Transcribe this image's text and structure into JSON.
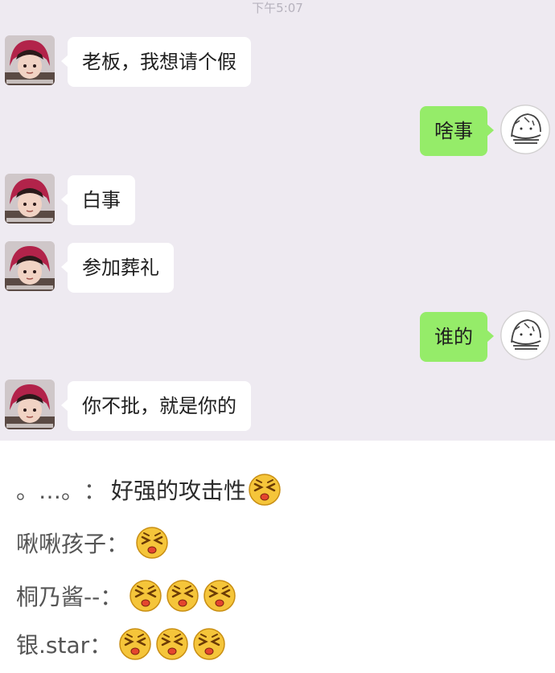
{
  "chat": {
    "time": "下午5:07",
    "messages": [
      {
        "side": "left",
        "text": "老板，我想请个假",
        "avatar": "girl-avatar-icon"
      },
      {
        "side": "right",
        "text": "啥事",
        "avatar": "sketch-avatar-icon"
      },
      {
        "side": "left",
        "text": "白事",
        "avatar": "girl-avatar-icon"
      },
      {
        "side": "left",
        "text": "参加葬礼",
        "avatar": "girl-avatar-icon"
      },
      {
        "side": "right",
        "text": "谁的",
        "avatar": "sketch-avatar-icon"
      },
      {
        "side": "left",
        "text": "你不批，就是你的",
        "avatar": "girl-avatar-icon"
      }
    ]
  },
  "comments": [
    {
      "name": "。…。",
      "sep": "：",
      "text": "好强的攻击性",
      "emoji_count": 1
    },
    {
      "name": "啾啾孩子",
      "sep": "：",
      "text": "",
      "emoji_count": 1
    },
    {
      "name": "桐乃酱--",
      "sep": "：",
      "text": "",
      "emoji_count": 3
    },
    {
      "name": "银.star",
      "sep": "：",
      "text": "",
      "emoji_count": 3
    }
  ],
  "colors": {
    "chat_bg": "#eeeaf1",
    "green_bubble": "#95ec69",
    "white_bubble": "#ffffff",
    "emoji_yellow": "#f5c53a"
  }
}
